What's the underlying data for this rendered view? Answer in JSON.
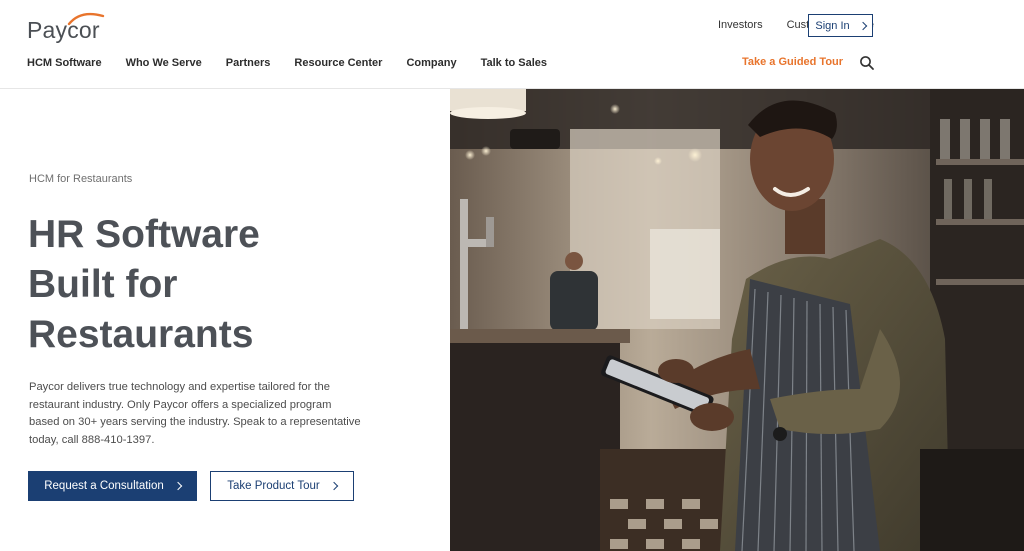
{
  "brand": {
    "logo_text": "Paycor",
    "accent": "#e8742c",
    "primary": "#1b3f73"
  },
  "utility_nav": {
    "investors": "Investors",
    "customer_service": "Customer Service",
    "sign_in": "Sign In"
  },
  "main_nav": {
    "items": [
      {
        "label": "HCM Software"
      },
      {
        "label": "Who We Serve"
      },
      {
        "label": "Partners"
      },
      {
        "label": "Resource Center"
      },
      {
        "label": "Company"
      },
      {
        "label": "Talk to Sales"
      }
    ],
    "guided_tour": "Take a Guided Tour",
    "search_icon": "search-icon"
  },
  "hero": {
    "eyebrow": "HCM for Restaurants",
    "title_lines": [
      "HR Software",
      "Built for",
      "Restaurants"
    ],
    "description": "Paycor delivers true technology and expertise tailored for the restaurant industry. Only Paycor offers a specialized program based on 30+ years serving the industry. Speak to a representative today, call 888-410-1397.",
    "primary_cta": "Request a Consultation",
    "secondary_cta": "Take Product Tour"
  }
}
